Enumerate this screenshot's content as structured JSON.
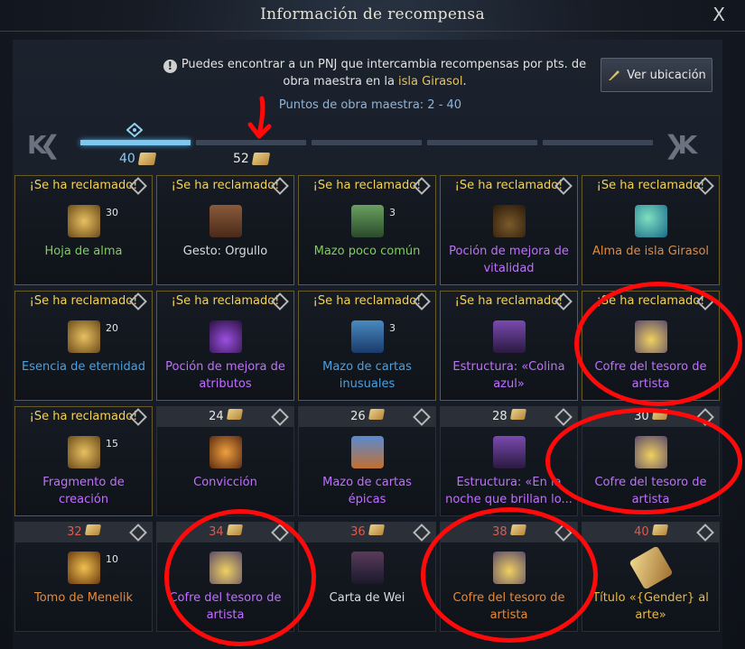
{
  "window": {
    "title": "Información de recompensa",
    "close": "X"
  },
  "info": {
    "text_before": "Puedes encontrar a un PNJ que intercambia recompensas por pts. de obra maestra en la ",
    "island": "isla Girasol",
    "text_after": ".",
    "locate_button": "Ver ubicación"
  },
  "points_label": "Puntos de obra maestra: 2 - 40",
  "navigation": {
    "prev": "K❮",
    "next": "❯K"
  },
  "milestones": {
    "first": "40",
    "second": "52"
  },
  "claimed_text": "¡Se ha reclamado!",
  "rewards": [
    {
      "name": "Hoja de alma",
      "color": "green",
      "icon": "i-book",
      "qty": "30",
      "status": "claimed"
    },
    {
      "name": "Gesto: Orgullo",
      "color": "white",
      "icon": "i-brown",
      "qty": "",
      "status": "claimed"
    },
    {
      "name": "Mazo poco común",
      "color": "green",
      "icon": "i-green",
      "qty": "3",
      "status": "claimed"
    },
    {
      "name": "Poción de mejora de vitalidad",
      "color": "purple",
      "icon": "i-potion",
      "qty": "",
      "status": "claimed"
    },
    {
      "name": "Alma de isla Girasol",
      "color": "orange",
      "icon": "i-globe",
      "qty": "",
      "status": "claimed"
    },
    {
      "name": "Esencia de eternidad",
      "color": "blue",
      "icon": "i-book",
      "qty": "20",
      "status": "claimed"
    },
    {
      "name": "Poción de mejora de atributos",
      "color": "purple",
      "icon": "i-purple-potion",
      "qty": "",
      "status": "claimed"
    },
    {
      "name": "Mazo de cartas inusuales",
      "color": "blue",
      "icon": "i-blue",
      "qty": "3",
      "status": "claimed"
    },
    {
      "name": "Estructura: «Colina azul»",
      "color": "purple",
      "icon": "i-struct",
      "qty": "",
      "status": "claimed"
    },
    {
      "name": "Cofre del tesoro de artista",
      "color": "purple",
      "icon": "i-chest",
      "qty": "",
      "status": "claimed"
    },
    {
      "name": "Fragmento de creación",
      "color": "purple",
      "icon": "i-book",
      "qty": "15",
      "status": "claimed"
    },
    {
      "name": "Convicción",
      "color": "purple",
      "icon": "i-rune",
      "qty": "",
      "status": "cost",
      "cost": "24"
    },
    {
      "name": "Mazo de cartas épicas",
      "color": "purple",
      "icon": "i-epic",
      "qty": "",
      "status": "cost",
      "cost": "26"
    },
    {
      "name": "Estructura: «En la noche que brillan lo...",
      "color": "purple",
      "icon": "i-struct",
      "qty": "",
      "status": "cost",
      "cost": "28"
    },
    {
      "name": "Cofre del tesoro de artista",
      "color": "purple",
      "icon": "i-chest",
      "qty": "",
      "status": "cost",
      "cost": "30"
    },
    {
      "name": "Tomo de Menelik",
      "color": "orange",
      "icon": "i-tome",
      "qty": "10",
      "status": "cost-red",
      "cost": "32"
    },
    {
      "name": "Cofre del tesoro de artista",
      "color": "purple",
      "icon": "i-chest",
      "qty": "",
      "status": "cost-red",
      "cost": "34"
    },
    {
      "name": "Carta de Wei",
      "color": "white",
      "icon": "i-card",
      "qty": "",
      "status": "cost-red",
      "cost": "36"
    },
    {
      "name": "Cofre del tesoro de artista",
      "color": "orange",
      "icon": "i-chest",
      "qty": "",
      "status": "cost-red",
      "cost": "38"
    },
    {
      "name": "Título «{Gender} al arte»",
      "color": "gold",
      "icon": "i-scroll",
      "qty": "",
      "status": "cost-red",
      "cost": "40"
    }
  ],
  "colors": {
    "accent": "#7ec7ee",
    "claimed": "#f3d35a",
    "annotation": "#ff0a0a"
  }
}
